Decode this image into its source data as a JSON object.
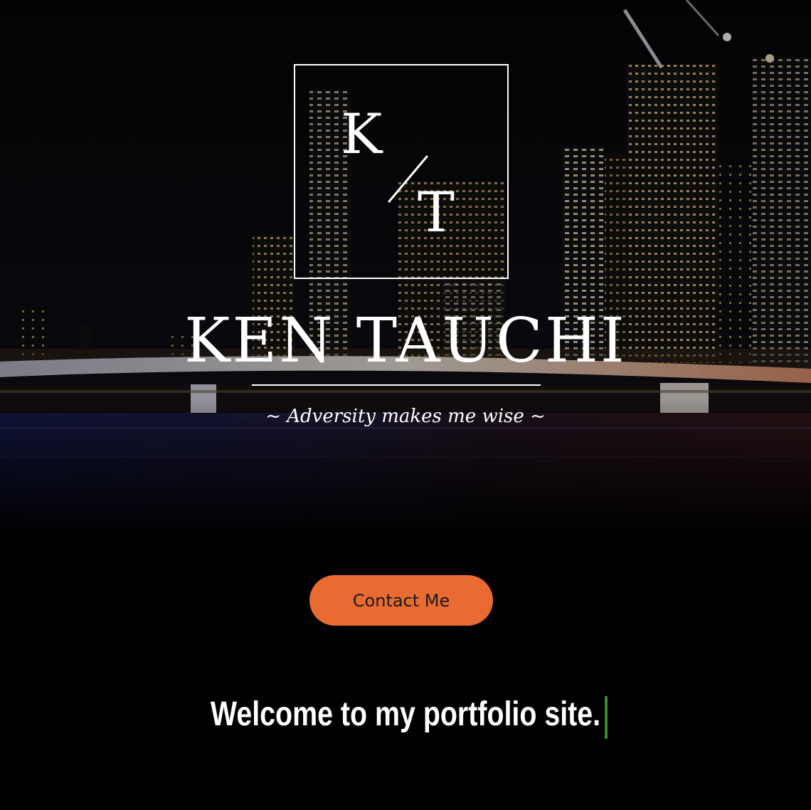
{
  "logo": {
    "letter_top": "K",
    "letter_bottom": "T"
  },
  "hero": {
    "name": "KEN TAUCHI",
    "tagline": "~ Adversity makes me wise ~"
  },
  "contact_button": {
    "label": "Contact Me"
  },
  "welcome": {
    "text": "Welcome to my portfolio site."
  },
  "colors": {
    "accent": "#ea6b31",
    "cursor": "#3a8a2e",
    "background": "#000000",
    "text": "#ffffff"
  }
}
